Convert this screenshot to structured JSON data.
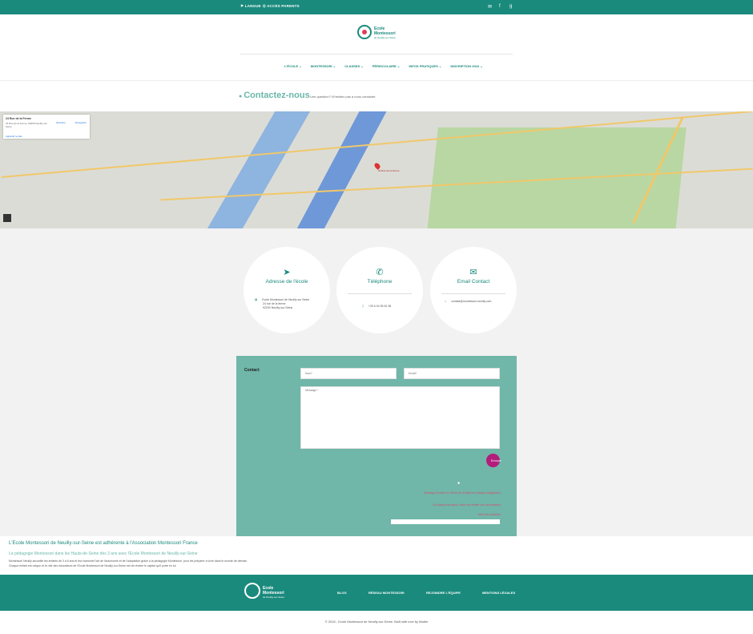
{
  "topbar": {
    "lang": "LANGUE",
    "parents": "ACCÈS PARENTS",
    "icons": [
      "mail-icon",
      "facebook-icon",
      "google-plus-icon"
    ],
    "icon_glyphs": [
      "✉",
      "f",
      "g"
    ]
  },
  "logo": {
    "line1": "Ecole",
    "line2": "Montessori",
    "line3": "de Neuilly-sur-Seine"
  },
  "nav": {
    "items": [
      "L'ÉCOLE",
      "MONTESSORI",
      "CLASSES",
      "PÉRISCOLAIRE",
      "INFOS PRATIQUES",
      "INSCRIPTION 2016"
    ]
  },
  "header": {
    "title": "Contactez-nous",
    "subtitle": "Une question? N'hésitez pas à nous contacter."
  },
  "map": {
    "card_title": "24 Rue de la Ferme",
    "card_address": "24 Rue de la Ferme, 92200 Neuilly-sur-Seine",
    "directions": "Itinéraire",
    "save": "Enregistré",
    "larger_map": "Agrandir le plan",
    "pin_label": "24 Rue de la Ferme"
  },
  "cards": [
    {
      "icon": "➤",
      "title": "Adresse de l'école",
      "lines": [
        "Ecole Montessori de Neuilly sur Seine",
        "24 rue de la ferme",
        "92200 Neuilly-sur-Seine"
      ],
      "bullet": "▤"
    },
    {
      "icon": "✆",
      "title": "Téléphone",
      "lines": [
        "+33 6 94 35 62 98"
      ],
      "bullet": "▯"
    },
    {
      "icon": "✉",
      "title": "Email Contact",
      "lines": [
        "contact@montessori-neuilly.com"
      ],
      "bullet": "⌂"
    }
  ],
  "form": {
    "label": "Contact",
    "name_placeholder": "Nom*",
    "email_placeholder": "Email*",
    "message_placeholder": "Message *",
    "send": "Envoyer",
    "error1": "Message d'erreur ici. Merci de remplir les champs obligatoires",
    "error2": "Ce champ est requis. Merci de vérifier vos informations",
    "error3": "Merci de patienter"
  },
  "info": {
    "heading": "L'Ecole Montessori de Neuilly-sur-Seine est adhérente à l'Association Montessori France",
    "subheading": "La pédagogie Montessori dans les Hauts-de-Seine dès 3 ans avec l'Ecole Montessori de Neuilly-sur-Seine",
    "p1": "Montessori Neuilly accueille les enfants de 3 à 6 ans et leur transmet l'art de l'autonomie et de l'adaptation grâce à la pédagogie Montessori, pour les préparer à vivre dans le monde de demain.",
    "p2": "Chaque enfant est unique et le rôle des éducateurs de l'Ecole Montessori de Neuilly-sur-Seine est de révéler le capital qu'il porte en lui."
  },
  "footer": {
    "links": [
      "BLOG",
      "RÉSEAU MONTESSORI",
      "REJOINDRE L'ÉQUIPE",
      "MENTIONS LÉGALES"
    ],
    "copyright": "© 2016 - Ecole Montessori de Neuilly-sur-Seine. Built with love by Martin"
  },
  "colors": {
    "brand": "#1a8a7d",
    "form_bg": "#70b6a9",
    "send_button": "#b21c7b"
  }
}
